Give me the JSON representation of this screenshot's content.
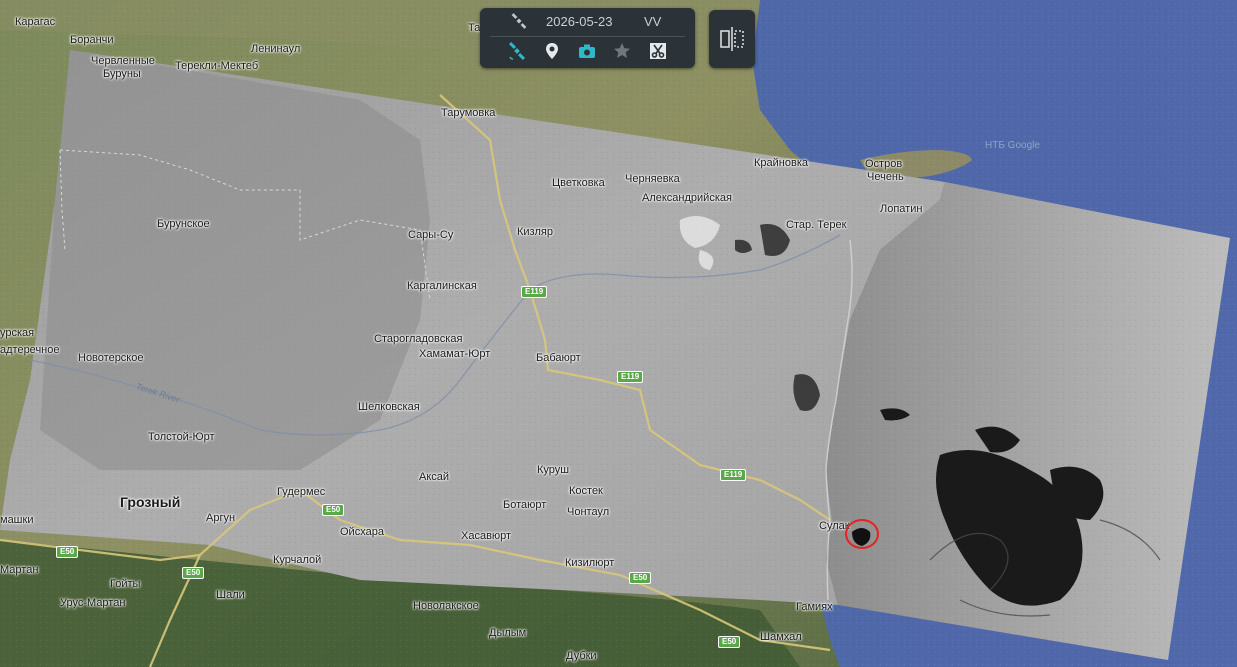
{
  "toolbar": {
    "date": "2026-05-23",
    "polarization": "VV",
    "icons": [
      "satellite-icon",
      "location-pin-icon",
      "camera-icon",
      "star-icon",
      "scissors-icon"
    ],
    "accent_color": "#2fb8c8"
  },
  "split_button": {
    "icon": "split-view-icon"
  },
  "watermark": "НТБ Google",
  "marker": {
    "color": "#e52222"
  },
  "places": {
    "karagas": "Карагас",
    "boranchi": "Боранчи",
    "chervlennye": "Червленные",
    "buruny": "Буруны",
    "tereklimekteb": "Терекли-Мектеб",
    "leninaul": "Ленинаул",
    "tarumovka": "Тарумовка",
    "krainovka": "Крайновка",
    "ostrov": "Остров",
    "chechen": "Чечень",
    "tsvetkovka": "Цветковка",
    "chernyaevka": "Черняевка",
    "aleksandriyskaya": "Александрийская",
    "lopatin": "Лопатин",
    "burunskoe": "Бурунское",
    "saryssu": "Сары-Су",
    "kizlyar": "Кизляр",
    "starterek": "Стар. Терек",
    "kargalinskaya": "Каргалинская",
    "naurskaya": "урская",
    "nadterechnoe": "адтеречное",
    "novoterskoe": "Новотерское",
    "starogladovskaya": "Старогладовская",
    "khamamatyurt": "Хамамат-Юрт",
    "babayurt": "Бабаюрт",
    "shelkovskaya": "Шелковская",
    "tolstoyyurt": "Толстой-Юрт",
    "aksay": "Аксай",
    "kurush": "Куруш",
    "kostek": "Костек",
    "groznyy": "Грозный",
    "gudermes": "Гудермес",
    "botayurt": "Ботаюрт",
    "chontaul": "Чонтаул",
    "argun": "Аргун",
    "oyskhara": "Ойсхара",
    "khasavyurt": "Хасавюрт",
    "sulak": "Сулак",
    "mashki": "машки",
    "martan": "Мартан",
    "kurchaloy": "Курчалой",
    "kizilyurt": "Кизилюрт",
    "goyty": "Гойты",
    "urusmartan": "Урус-Мартан",
    "shali": "Шали",
    "gamiyakh": "Гамиях",
    "novolakskoe": "Новолакское",
    "shamkhal": "Шамхал",
    "dylym": "Дылым",
    "dubki": "Дубки",
    "tereklabel": "Terek River",
    "ta": "Та"
  },
  "roads": {
    "e119": "E119",
    "e50": "E50"
  }
}
